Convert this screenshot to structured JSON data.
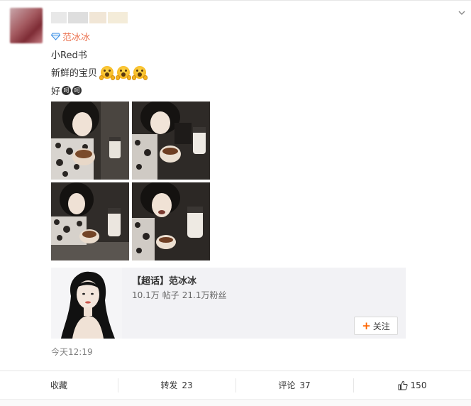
{
  "post": {
    "author": "范冰冰",
    "lines": {
      "line1": "小Red书",
      "line2": "新鲜的宝贝",
      "line3": "好"
    },
    "emoji_line2": [
      "scream-emoji",
      "scream-emoji",
      "scream-emoji"
    ],
    "emoji_line3": [
      "hehe-emoji",
      "hehe-emoji"
    ],
    "hehe_glyph": "呵",
    "timestamp": "今天12:19"
  },
  "topic": {
    "title": "【超话】范冰冰",
    "stat_posts": "10.1万",
    "stat_posts_label": "帖子",
    "stat_fans": "21.1万粉丝",
    "follow_label": "关注"
  },
  "actions": {
    "favorite": "收藏",
    "repost_label": "转发",
    "repost_count": "23",
    "comment_label": "评论",
    "comment_count": "37",
    "like_count": "150"
  },
  "colors": {
    "author_link": "#eb7350",
    "follow_plus": "#ff6600",
    "topic_bg": "#f2f2f5"
  }
}
